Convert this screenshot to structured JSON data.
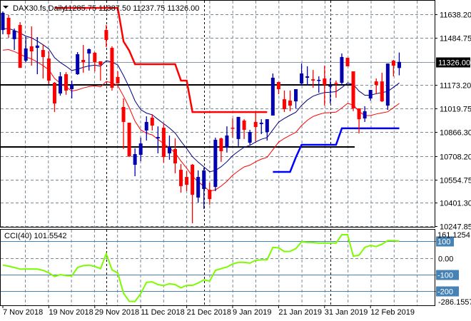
{
  "header": {
    "menu_icon": "triangle-down-icon",
    "symbol": "DAX30.fs,Daily",
    "ohlc_text": "11285.75 11387.50 11237.75 11326.00"
  },
  "price_axis": {
    "ticks": [
      "11638.20",
      "11484.75",
      "11173.20",
      "11019.75",
      "10866.30",
      "10708.20",
      "10554.75",
      "10401.30",
      "10247.85"
    ],
    "tick_values": [
      11638.2,
      11484.75,
      11173.2,
      11019.75,
      10866.3,
      10708.2,
      10554.75,
      10401.3,
      10247.85
    ],
    "current_price_label": "11326.00",
    "current_price": 11326.0
  },
  "cci_panel": {
    "label": "CCI(40) 101.5542",
    "max_label": "161.1254",
    "min_label": "-286.1557",
    "zero_label": "0.00",
    "level_labels": [
      "100",
      "-100",
      "-200"
    ],
    "levels": [
      100,
      -100,
      -200
    ],
    "range": [
      -286.1557,
      161.1254
    ]
  },
  "colors": {
    "bull": "#0000b0",
    "bear": "#ff0000",
    "ma_fast": "#000080",
    "ma_slow": "#ff0000",
    "stop_upper": "#ff0000",
    "stop_lower": "#0000ff",
    "cci_line": "#7cfc00",
    "cci_levels": "#4682b4",
    "support_lines": "#000000"
  },
  "chart_data": {
    "type": "candlestick",
    "title": "DAX30.fs,Daily",
    "ylim": [
      10247.85,
      11638.2
    ],
    "x_labels": [
      {
        "label": "7 Nov 2018",
        "index": 1
      },
      {
        "label": "19 Nov 2018",
        "index": 9
      },
      {
        "label": "29 Nov 2018",
        "index": 17
      },
      {
        "label": "11 Dec 2018",
        "index": 25
      },
      {
        "label": "21 Dec 2018",
        "index": 33
      },
      {
        "label": "9 Jan 2019",
        "index": 41
      },
      {
        "label": "21 Jan 2019",
        "index": 49
      },
      {
        "label": "31 Jan 2019",
        "index": 57
      },
      {
        "label": "12 Feb 2019",
        "index": 65
      }
    ],
    "month_separators": [
      18,
      35,
      57
    ],
    "ohlc": [
      [
        11535,
        11657,
        11507,
        11648
      ],
      [
        11615,
        11634,
        11484,
        11507
      ],
      [
        11475,
        11545,
        11404,
        11531
      ],
      [
        11568,
        11587,
        11287,
        11287
      ],
      [
        11334,
        11489,
        11325,
        11414
      ],
      [
        11428,
        11559,
        11301,
        11395
      ],
      [
        11418,
        11489,
        11245,
        11433
      ],
      [
        11404,
        11442,
        11217,
        11358
      ],
      [
        11348,
        11395,
        11180,
        11203
      ],
      [
        11189,
        11194,
        10997,
        11053
      ],
      [
        11119,
        11259,
        11105,
        11231
      ],
      [
        11245,
        11259,
        11110,
        11138
      ],
      [
        11147,
        11203,
        11086,
        11175
      ],
      [
        11245,
        11390,
        11241,
        11376
      ],
      [
        11339,
        11437,
        11255,
        11325
      ],
      [
        11381,
        11414,
        11269,
        11409
      ],
      [
        11386,
        11390,
        11264,
        11325
      ],
      [
        11330,
        11330,
        11203,
        11306
      ],
      [
        11535,
        11568,
        11423,
        11470
      ],
      [
        11418,
        11428,
        11138,
        11156
      ],
      [
        11227,
        11264,
        11184,
        11184
      ],
      [
        11030,
        11086,
        10754,
        10932
      ],
      [
        10927,
        10927,
        10702,
        10707
      ],
      [
        10651,
        10759,
        10576,
        10721
      ],
      [
        10716,
        10829,
        10674,
        10791
      ],
      [
        10876,
        10969,
        10810,
        10932
      ],
      [
        10960,
        10983,
        10876,
        10908
      ],
      [
        10824,
        10903,
        10726,
        10833
      ],
      [
        10894,
        10922,
        10665,
        10702
      ],
      [
        10726,
        10843,
        10684,
        10768
      ],
      [
        10754,
        10824,
        10595,
        10660
      ],
      [
        10618,
        10656,
        10468,
        10511
      ],
      [
        10571,
        10609,
        10478,
        10520
      ],
      [
        10651,
        10656,
        10267,
        10454
      ],
      [
        10436,
        10614,
        10403,
        10571
      ],
      [
        10492,
        10632,
        10361,
        10614
      ],
      [
        10487,
        10534,
        10389,
        10426
      ],
      [
        10506,
        10829,
        10478,
        10815
      ],
      [
        10824,
        10829,
        10670,
        10740
      ],
      [
        10763,
        10903,
        10731,
        10843
      ],
      [
        10894,
        10955,
        10829,
        10890
      ],
      [
        10820,
        10965,
        10773,
        10965
      ],
      [
        10941,
        10950,
        10820,
        10880
      ],
      [
        10796,
        10880,
        10782,
        10866
      ],
      [
        10932,
        10993,
        10805,
        10899
      ],
      [
        10918,
        10950,
        10852,
        10927
      ],
      [
        10866,
        10950,
        10810,
        10950
      ],
      [
        10974,
        11250,
        10974,
        11222
      ],
      [
        11194,
        11194,
        11114,
        11147
      ],
      [
        11081,
        11138,
        10997,
        11016
      ],
      [
        11072,
        11138,
        11002,
        11039
      ],
      [
        11067,
        11147,
        11021,
        11147
      ],
      [
        11184,
        11315,
        11170,
        11250
      ],
      [
        11222,
        11297,
        11170,
        11231
      ],
      [
        11212,
        11273,
        11156,
        11203
      ],
      [
        11203,
        11231,
        11124,
        11208
      ],
      [
        11217,
        11301,
        11039,
        11175
      ],
      [
        11166,
        11217,
        11053,
        11170
      ],
      [
        11189,
        11203,
        11091,
        11184
      ],
      [
        11189,
        11381,
        11175,
        11358
      ],
      [
        11353,
        11353,
        11297,
        11297
      ],
      [
        11264,
        11264,
        11003,
        11021
      ],
      [
        11021,
        11021,
        10857,
        10950
      ],
      [
        10955,
        11035,
        10932,
        11002
      ],
      [
        11086,
        11142,
        11072,
        11142
      ],
      [
        11198,
        11217,
        11114,
        11175
      ],
      [
        11198,
        11255,
        11063,
        11067
      ],
      [
        11039,
        11315,
        11011,
        11315
      ],
      [
        11334,
        11339,
        11231,
        11301
      ],
      [
        11285.75,
        11387.5,
        11237.75,
        11326.0
      ]
    ],
    "support_levels": [
      11175,
      10768
    ],
    "support_end_index": 62,
    "stop_upper": [
      null,
      null,
      null,
      null,
      null,
      null,
      null,
      null,
      null,
      11680,
      11680,
      11680,
      11680,
      11680,
      11680,
      11680,
      11680,
      11680,
      11680,
      11680,
      11680,
      11460,
      11400,
      11311,
      11311,
      11311,
      11311,
      11311,
      11311,
      11311,
      11311,
      11203,
      11203,
      10997,
      10997,
      10997,
      10997,
      10997,
      10997,
      10997,
      10997,
      10997,
      10997,
      10997,
      10997,
      10997,
      10997,
      null,
      null,
      null,
      null,
      null,
      null,
      null,
      null,
      null,
      null,
      null,
      null,
      null,
      null,
      null,
      null,
      null,
      null,
      null,
      null,
      null,
      null,
      null
    ],
    "stop_lower": [
      null,
      null,
      null,
      null,
      null,
      null,
      null,
      null,
      null,
      null,
      null,
      null,
      null,
      null,
      null,
      null,
      null,
      null,
      null,
      null,
      null,
      null,
      null,
      null,
      null,
      null,
      null,
      null,
      null,
      null,
      null,
      null,
      null,
      null,
      null,
      null,
      null,
      null,
      null,
      null,
      null,
      null,
      null,
      null,
      null,
      null,
      null,
      10604,
      10604,
      10604,
      10604,
      10700,
      10782,
      10782,
      10782,
      10782,
      10782,
      10782,
      10782,
      10890,
      10890,
      10890,
      10890,
      10890,
      10890,
      10890,
      10890,
      10890,
      10890,
      10890
    ],
    "cci": [
      -43,
      -49,
      -57,
      -67,
      -66,
      -66,
      -67,
      -74,
      -89,
      -111,
      -100,
      -106,
      -107,
      -57,
      -46,
      -43,
      -50,
      -64,
      26,
      -71,
      -90,
      -211,
      -260,
      -261,
      -214,
      -146,
      -143,
      -160,
      -166,
      -154,
      -160,
      -179,
      -164,
      -164,
      -150,
      -131,
      -139,
      -74,
      -64,
      -54,
      -36,
      -26,
      -26,
      -31,
      -14,
      -11,
      -10,
      64,
      61,
      39,
      40,
      57,
      97,
      94,
      93,
      90,
      90,
      90,
      90,
      140,
      140,
      11,
      17,
      64,
      76,
      69,
      83,
      104,
      104,
      101.5542
    ]
  }
}
